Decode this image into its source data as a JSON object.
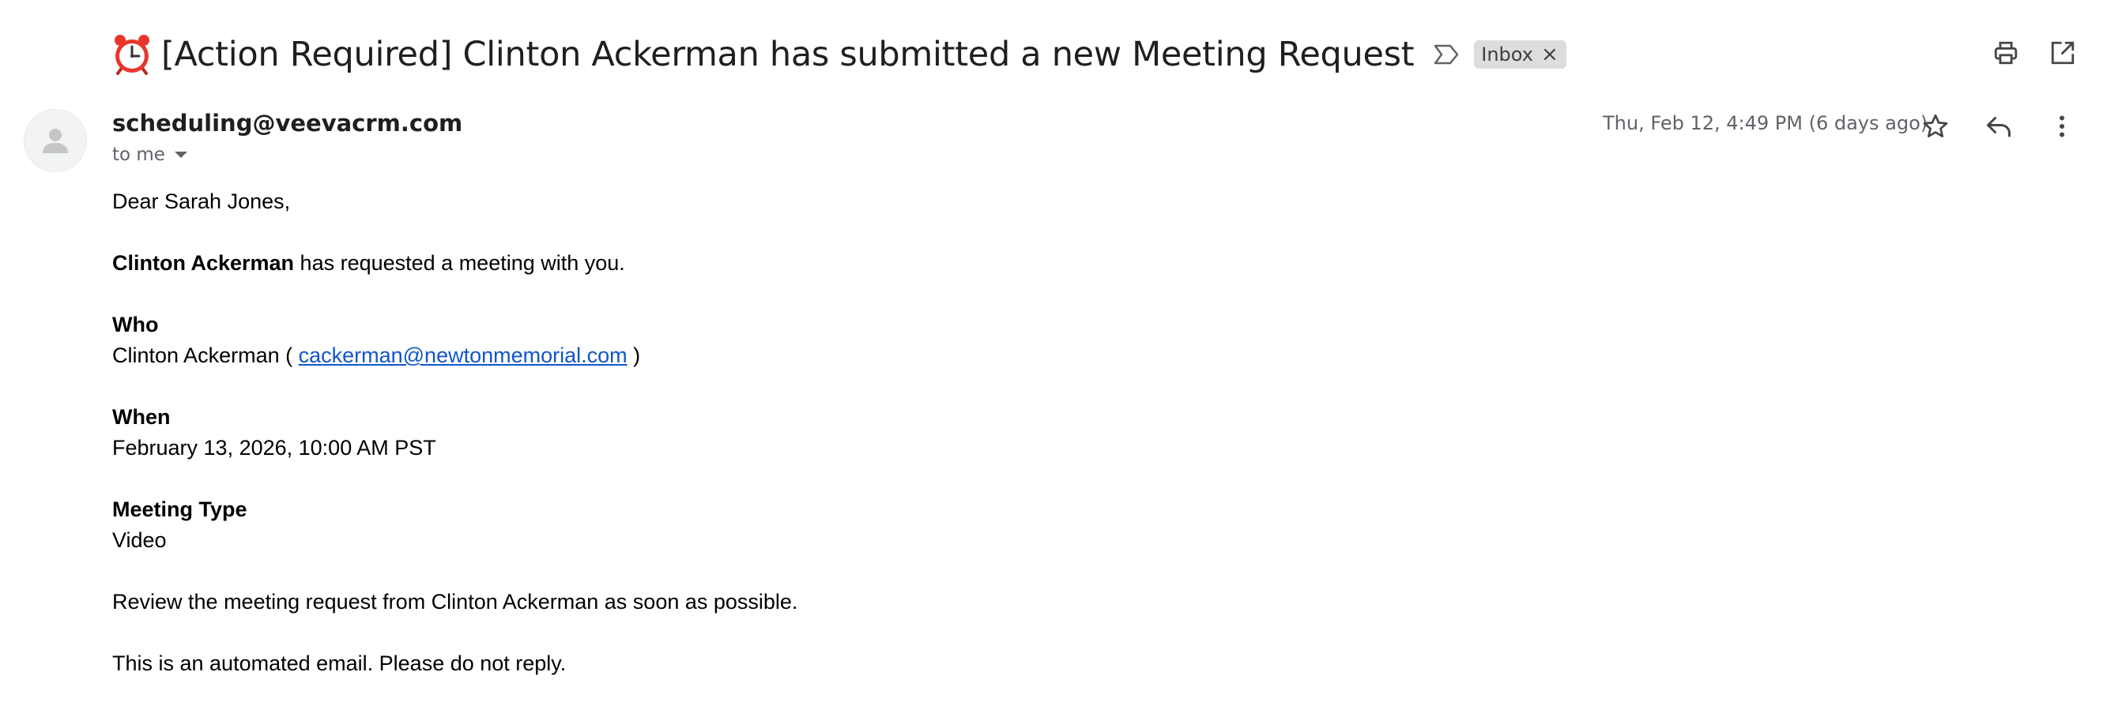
{
  "email": {
    "subject": "[Action Required] Clinton Ackerman has submitted a new Meeting Request",
    "subject_emoji": "alarm-clock-icon",
    "label": "Inbox",
    "label_remove_symbol": "×",
    "sender": "scheduling@veevacrm.com",
    "recipient": "to me",
    "timestamp": "Thu, Feb 12, 4:49 PM (6 days ago)"
  },
  "body": {
    "greeting": "Dear Sarah Jones,",
    "requester_name": "Clinton Ackerman",
    "request_text": " has requested a meeting with you.",
    "who_heading": "Who",
    "who_name_prefix": "Clinton Ackerman ( ",
    "who_email": "cackerman@newtonmemorial.com",
    "who_suffix": " )",
    "when_heading": "When",
    "when_value": "February 13, 2026, 10:00 AM PST",
    "type_heading": "Meeting Type",
    "type_value": "Video",
    "review_text": "Review the meeting request from Clinton Ackerman as soon as possible.",
    "automated_text": "This is an automated email. Please do not reply."
  },
  "icons": {
    "importance": "importance-marker-icon",
    "print": "print-icon",
    "new_window": "open-in-new-window-icon",
    "star": "star-icon",
    "reply": "reply-icon",
    "more": "more-vertical-icon",
    "avatar": "default-avatar-icon"
  },
  "colors": {
    "link": "#1155cc",
    "chip_bg": "#dddddd",
    "secondary_text": "#5f6368",
    "alarm_red": "#e8362d"
  }
}
